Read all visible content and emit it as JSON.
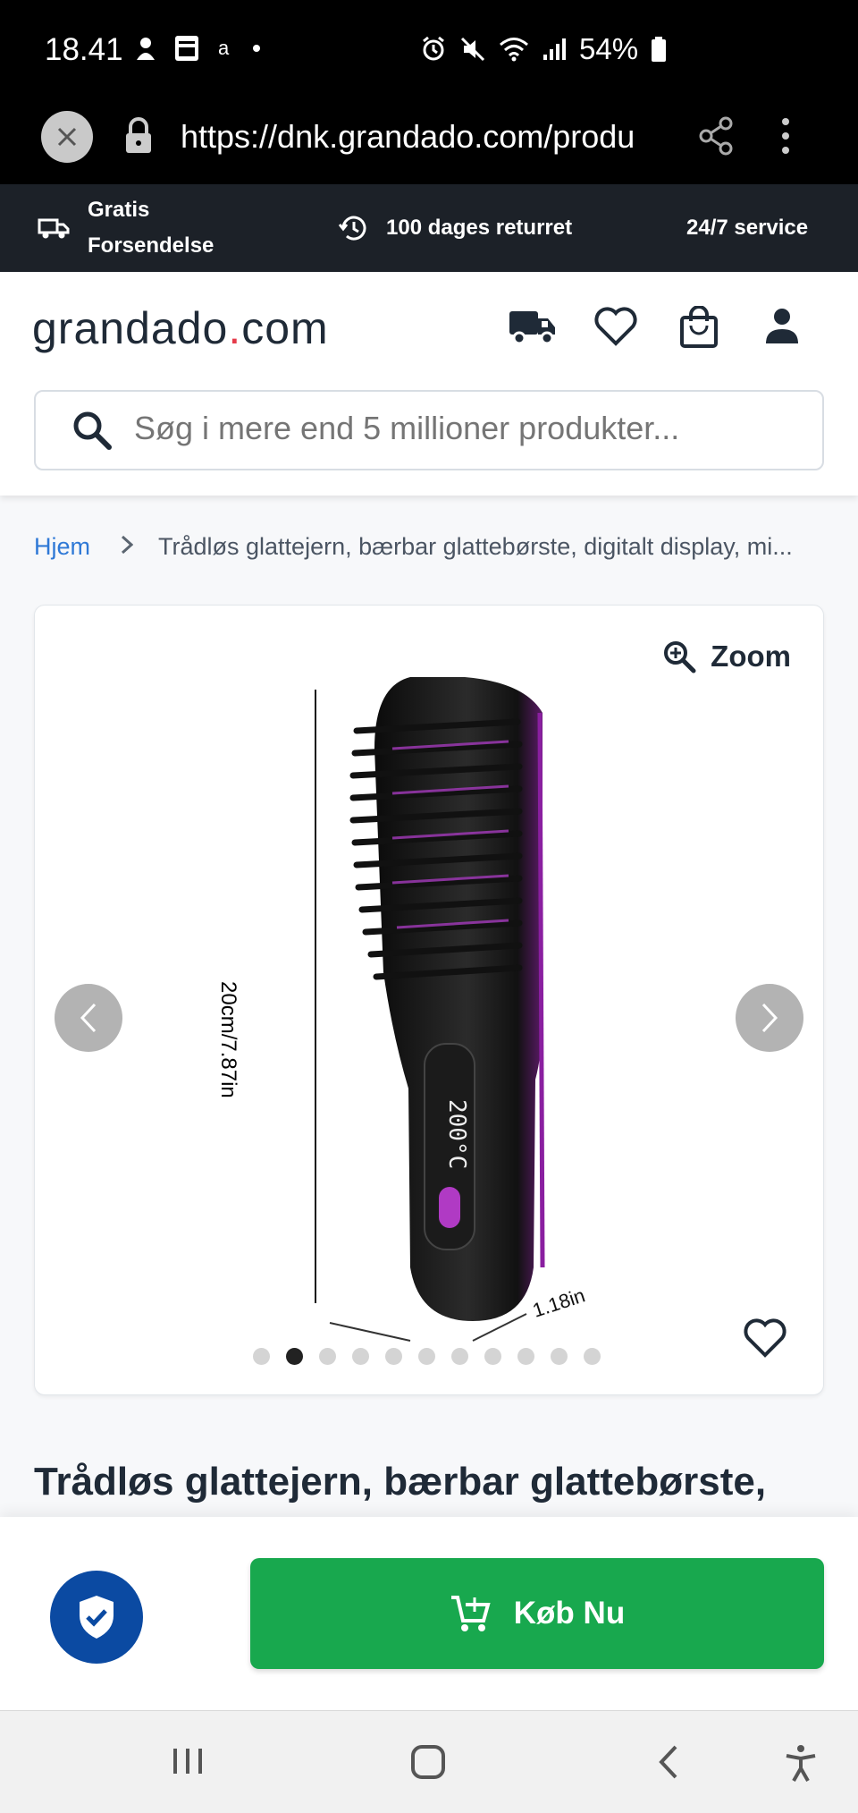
{
  "status_bar": {
    "time": "18.41",
    "left_icons": [
      "notification-icon",
      "sim-icon",
      "app-icon",
      "dot-icon"
    ],
    "right_icons": [
      "alarm-icon",
      "mute-icon",
      "wifi-icon",
      "signal-icon"
    ],
    "battery": "54%"
  },
  "browser": {
    "url": "https://dnk.grandado.com/produ"
  },
  "promo": {
    "shipping": "Gratis Forsendelse",
    "returns": "100 dages returret",
    "service": "24/7 service"
  },
  "header": {
    "logo_main": "grandado",
    "logo_dot": ".",
    "logo_tld": "com",
    "icons": [
      "truck-icon",
      "heart-icon",
      "bag-icon",
      "user-icon"
    ]
  },
  "search": {
    "placeholder": "Søg i mere end 5 millioner produkter..."
  },
  "breadcrumb": {
    "home": "Hjem",
    "current": "Trådløs glattejern, bærbar glattebørste, digitalt display, mi..."
  },
  "gallery": {
    "zoom_label": "Zoom",
    "image_height_label": "20cm/7.87in",
    "image_width_label": "1.18in",
    "image_display": "200°C",
    "image_count": 11,
    "active_index": 1
  },
  "product": {
    "title": "Trådløs glattejern, bærbar glattebørste,"
  },
  "buy_bar": {
    "buy_label": "Køb Nu"
  },
  "colors": {
    "buy_button": "#18a84e",
    "trust_badge": "#0b4aa2",
    "link": "#2f79d6",
    "logo_dot": "#e53b4a",
    "promo_bg": "#1c2128"
  }
}
